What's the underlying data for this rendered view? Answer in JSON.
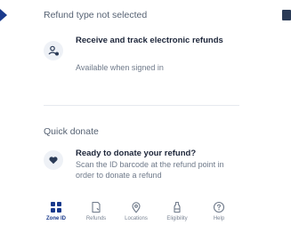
{
  "sections": {
    "refund_type": {
      "title": "Refund type not selected",
      "card": {
        "icon": "user-plus-icon",
        "title": "Receive and track electronic refunds",
        "description": "Available when signed in"
      }
    },
    "quick_donate": {
      "title": "Quick donate",
      "card": {
        "icon": "heart-icon",
        "title": "Ready to donate your refund?",
        "description": "Scan the ID barcode at the refund point in order to donate a refund"
      }
    }
  },
  "bottom_nav": {
    "active": "Zone ID",
    "items": [
      {
        "label": "Zone ID",
        "icon": "grid-icon"
      },
      {
        "label": "Refunds",
        "icon": "receipt-icon"
      },
      {
        "label": "Locations",
        "icon": "location-pin-icon"
      },
      {
        "label": "Eligibility",
        "icon": "bottle-icon"
      },
      {
        "label": "Help",
        "icon": "help-circle-icon"
      }
    ]
  },
  "colors": {
    "primary": "#1a3a8c",
    "text_dark": "#1c2539",
    "text_muted": "#6f7a8a",
    "icon_bg": "#eef1f6",
    "divider": "#e6e9ef"
  }
}
